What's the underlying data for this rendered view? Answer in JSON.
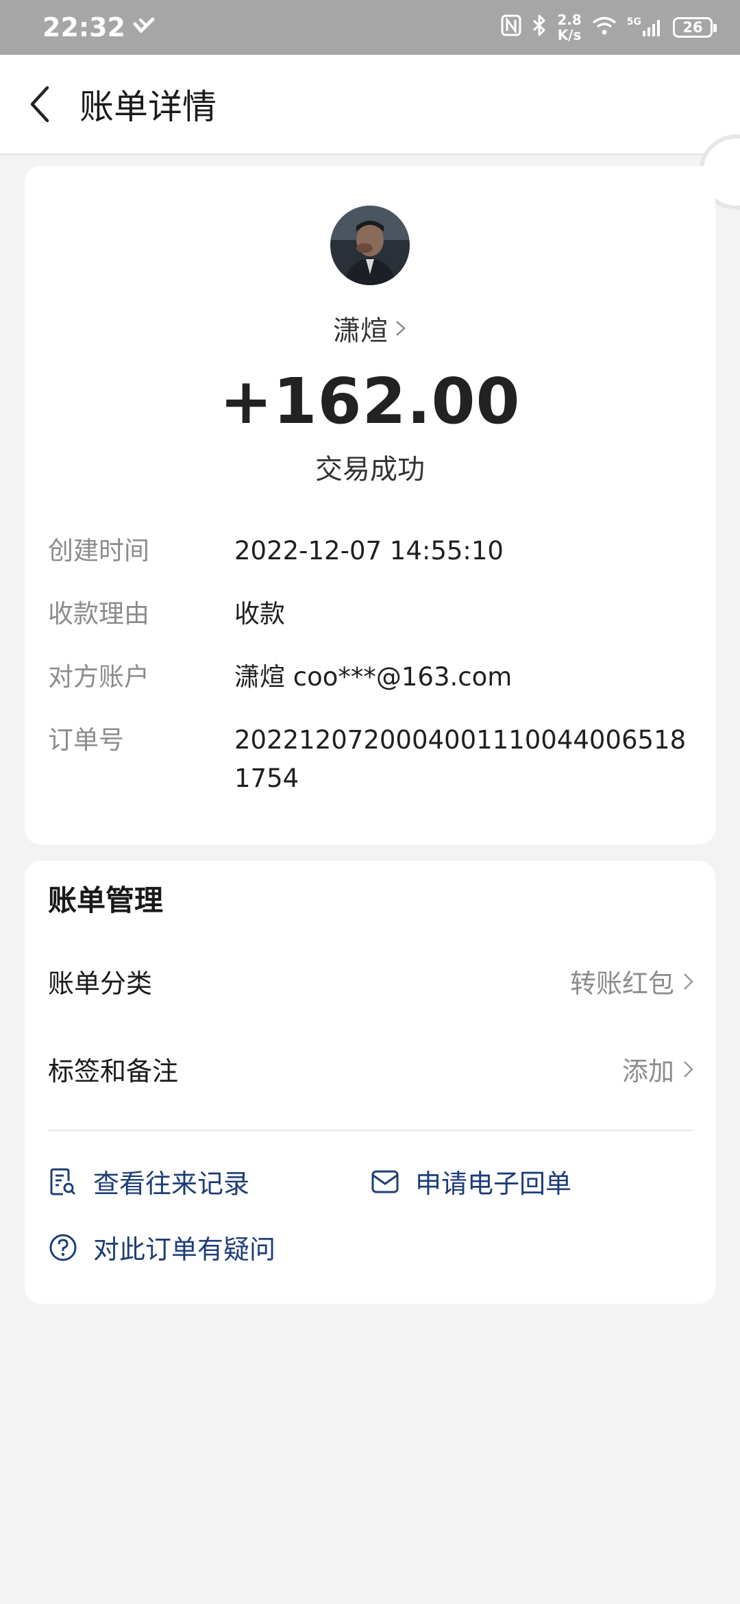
{
  "status_bar": {
    "time": "22:32",
    "network_speed_value": "2.8",
    "network_speed_unit": "K/s",
    "network_type": "5G",
    "battery": "26"
  },
  "header": {
    "title": "账单详情"
  },
  "summary": {
    "payer_name": "潇煊",
    "amount": "+162.00",
    "status": "交易成功"
  },
  "details": [
    {
      "label": "创建时间",
      "value": "2022-12-07 14:55:10"
    },
    {
      "label": "收款理由",
      "value": "收款"
    },
    {
      "label": "对方账户",
      "value": "潇煊 coo***@163.com"
    },
    {
      "label": "订单号",
      "value": "20221207200040011100440065181754"
    }
  ],
  "manage": {
    "title": "账单管理",
    "rows": [
      {
        "label": "账单分类",
        "value": "转账红包"
      },
      {
        "label": "标签和备注",
        "value": "添加"
      }
    ],
    "actions": [
      {
        "label": "查看往来记录",
        "icon": "records-search-icon"
      },
      {
        "label": "申请电子回单",
        "icon": "envelope-icon"
      },
      {
        "label": "对此订单有疑问",
        "icon": "question-icon"
      }
    ]
  },
  "colors": {
    "accent_link": "#1d3d78",
    "muted": "#8c8c8c",
    "background": "#f3f3f3"
  }
}
